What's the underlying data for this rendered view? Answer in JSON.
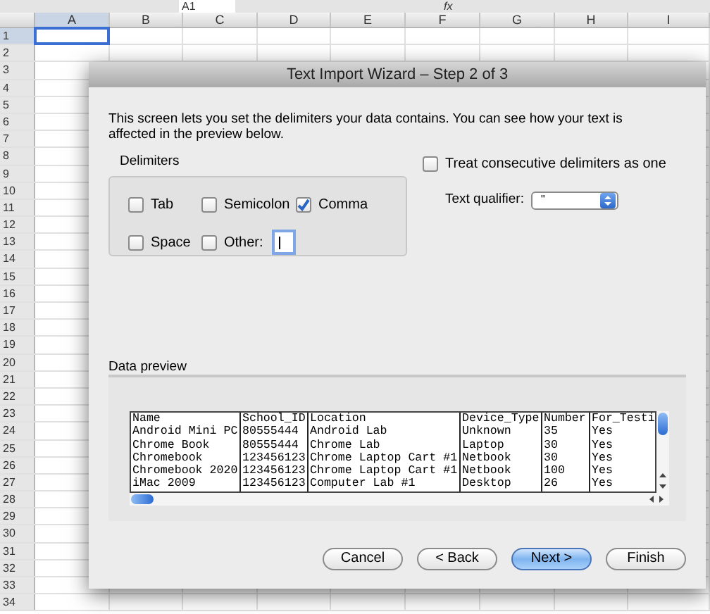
{
  "sheet": {
    "name_box": "A1",
    "formula_icon": "fx",
    "columns": [
      "A",
      "B",
      "C",
      "D",
      "E",
      "F",
      "G",
      "H",
      "I"
    ],
    "rows": [
      "1",
      "2",
      "3",
      "4",
      "5",
      "6",
      "7",
      "8",
      "9",
      "10",
      "11",
      "12",
      "13",
      "14",
      "15",
      "16",
      "17",
      "18",
      "19",
      "20",
      "21",
      "22",
      "23",
      "24",
      "25",
      "26",
      "27",
      "28",
      "29",
      "30",
      "31",
      "32",
      "33",
      "34"
    ]
  },
  "dialog": {
    "title": "Text Import Wizard – Step 2 of 3",
    "intro": "This screen lets you set the delimiters your data contains.  You can see how your text is affected in the preview below.",
    "delimiters": {
      "label": "Delimiters",
      "options": [
        {
          "label": "Tab",
          "checked": false
        },
        {
          "label": "Semicolon",
          "checked": false
        },
        {
          "label": "Comma",
          "checked": true
        },
        {
          "label": "Space",
          "checked": false
        },
        {
          "label": "Other:",
          "checked": false
        }
      ]
    },
    "consecutive": {
      "label": "Treat consecutive delimiters as one",
      "checked": false
    },
    "text_qualifier": {
      "label": "Text qualifier:",
      "value": "\""
    },
    "preview": {
      "label": "Data preview",
      "columns": [
        "Name",
        "School_ID",
        "Location",
        "Device_Type",
        "Number",
        "For_Testi"
      ],
      "rows": [
        [
          "Android Mini PC",
          "80555444",
          "Android Lab",
          "Unknown",
          "35",
          "Yes"
        ],
        [
          "Chrome Book",
          "80555444",
          "Chrome Lab",
          "Laptop",
          "30",
          "Yes"
        ],
        [
          "Chromebook",
          "123456123",
          "Chrome Laptop Cart #1",
          "Netbook",
          "30",
          "Yes"
        ],
        [
          "Chromebook 2020",
          "123456123",
          "Chrome Laptop Cart #1",
          "Netbook",
          "100",
          "Yes"
        ],
        [
          "iMac 2009",
          "123456123",
          "Computer Lab #1",
          "Desktop",
          "26",
          "Yes"
        ]
      ]
    },
    "buttons": [
      {
        "label": "Cancel",
        "default": false
      },
      {
        "label": "< Back",
        "default": false
      },
      {
        "label": "Next >",
        "default": true
      },
      {
        "label": "Finish",
        "default": false
      }
    ]
  }
}
